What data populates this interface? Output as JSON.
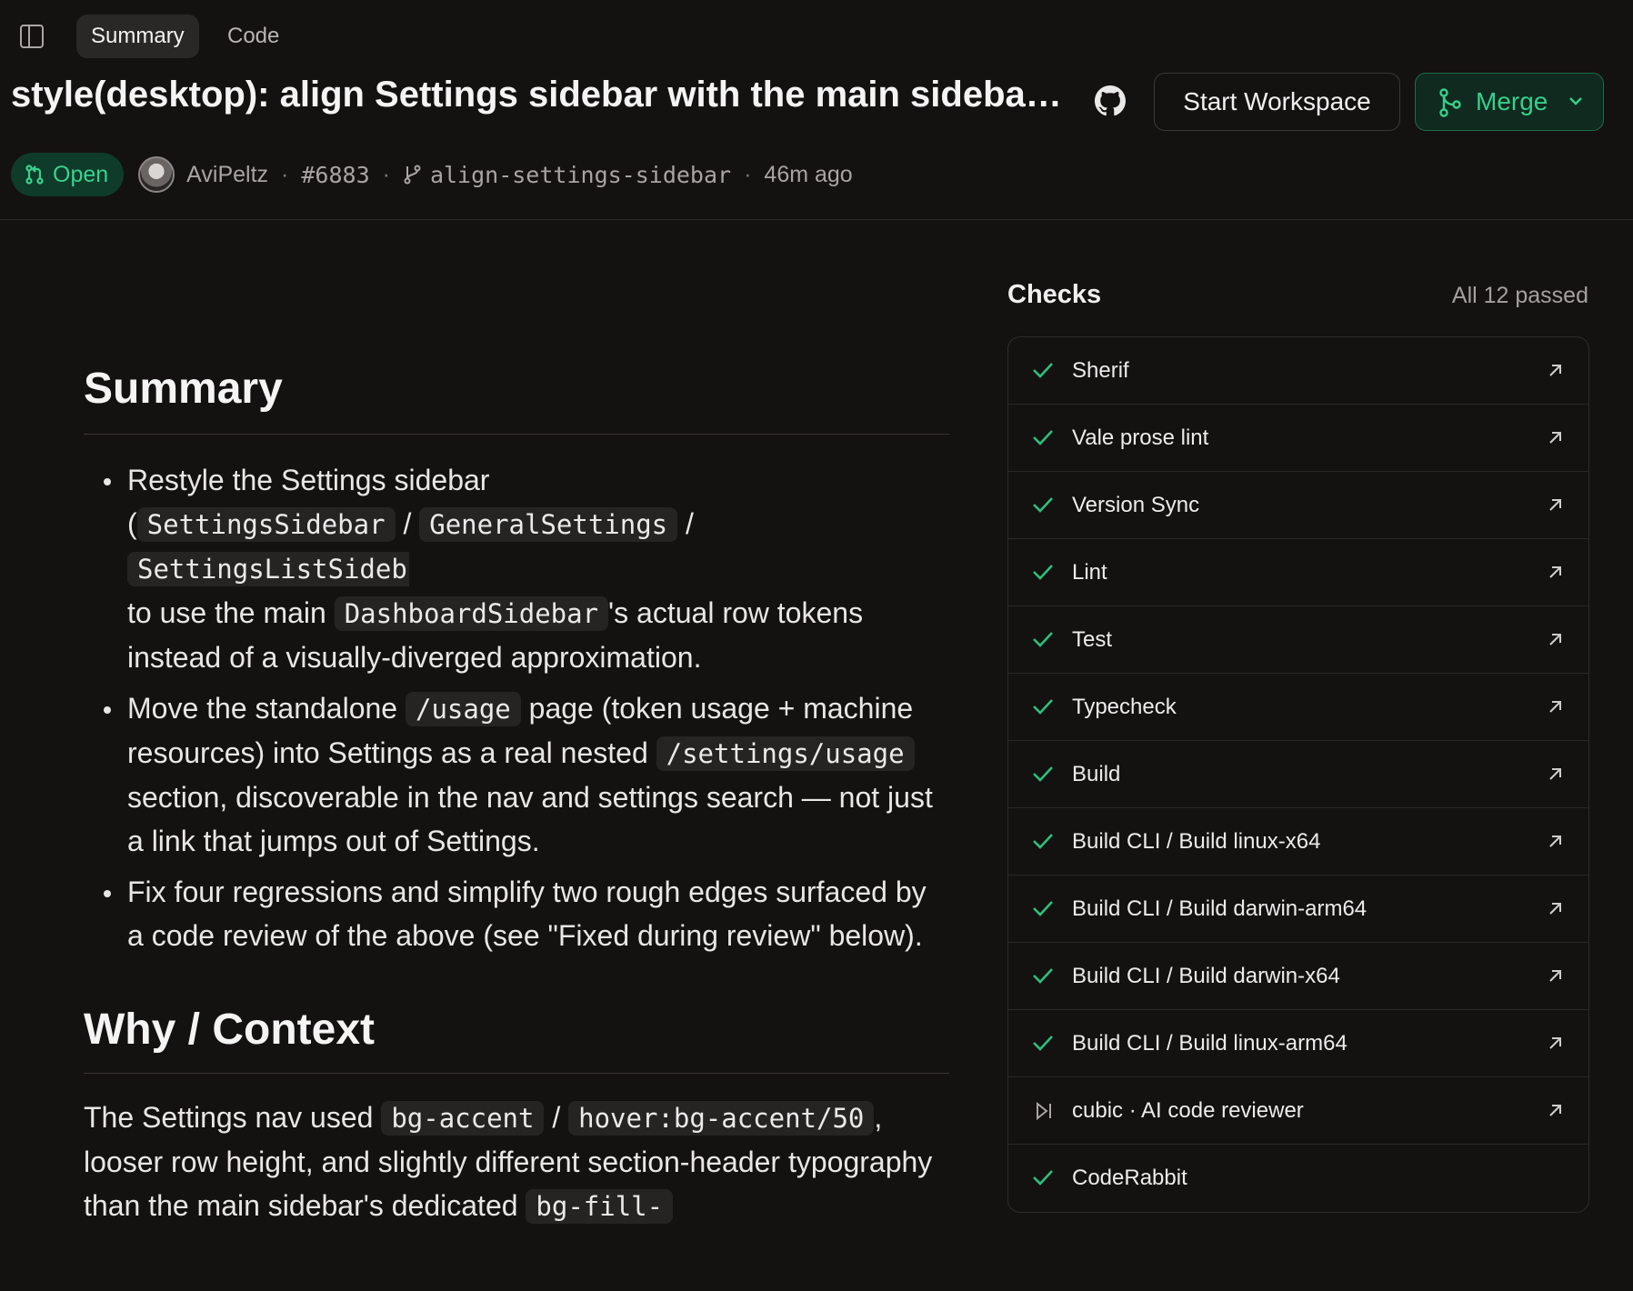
{
  "tabs": [
    {
      "label": "Summary",
      "active": true
    },
    {
      "label": "Code",
      "active": false
    }
  ],
  "header": {
    "title": "style(desktop): align Settings sidebar with the main sidebar, f...",
    "start_workspace_label": "Start Workspace",
    "merge_label": "Merge"
  },
  "meta": {
    "status": "Open",
    "author": "AviPeltz",
    "sep": "·",
    "pr_number": "#6883",
    "branch": "align-settings-sidebar",
    "time": "46m ago"
  },
  "content": {
    "summary_heading": "Summary",
    "bullet1": {
      "t1": "Restyle the Settings sidebar",
      "t2": "(",
      "c1": "SettingsSidebar",
      "t3": "/",
      "c2": "GeneralSettings",
      "t4": "/",
      "c3": "SettingsListSideb",
      "t5": "to use the main",
      "c4": "DashboardSidebar",
      "t6": "'s actual row tokens instead of a visually-diverged approximation."
    },
    "bullet2": {
      "t1": "Move the standalone",
      "c1": "/usage",
      "t2": "page (token usage + machine resources) into Settings as a real nested",
      "c2": "/settings/usage",
      "t3": "section, discoverable in the nav and settings search — not just a link that jumps out of Settings."
    },
    "bullet3": {
      "t1": "Fix four regressions and simplify two rough edges surfaced by a code review of the above (see \"Fixed during review\" below)."
    },
    "context_heading": "Why / Context",
    "para": {
      "t1": "The Settings nav used",
      "c1": "bg-accent",
      "t2": "/",
      "c2": "hover:bg-accent/50",
      "t3": ", looser row height, and slightly different section-header typography than the main sidebar's dedicated",
      "c3": "bg-fill-"
    }
  },
  "checks": {
    "title": "Checks",
    "summary": "All 12 passed",
    "items": [
      {
        "name": "Sherif",
        "status": "passed",
        "link": true
      },
      {
        "name": "Vale prose lint",
        "status": "passed",
        "link": true
      },
      {
        "name": "Version Sync",
        "status": "passed",
        "link": true
      },
      {
        "name": "Lint",
        "status": "passed",
        "link": true
      },
      {
        "name": "Test",
        "status": "passed",
        "link": true
      },
      {
        "name": "Typecheck",
        "status": "passed",
        "link": true
      },
      {
        "name": "Build",
        "status": "passed",
        "link": true
      },
      {
        "name": "Build CLI / Build linux-x64",
        "status": "passed",
        "link": true
      },
      {
        "name": "Build CLI / Build darwin-arm64",
        "status": "passed",
        "link": true
      },
      {
        "name": "Build CLI / Build darwin-x64",
        "status": "passed",
        "link": true
      },
      {
        "name": "Build CLI / Build linux-arm64",
        "status": "passed",
        "link": true
      },
      {
        "name": "cubic · AI code reviewer",
        "status": "skipped",
        "link": true
      },
      {
        "name": "CodeRabbit",
        "status": "passed",
        "link": false
      }
    ]
  },
  "colors": {
    "background": "#141111",
    "accent_green": "#36d08a",
    "check_green": "#2fbf7c"
  },
  "icons": {
    "sidebar_toggle": "sidebar-toggle-icon",
    "github": "github-icon",
    "merge": "git-merge-icon",
    "chevron": "chevron-down-icon",
    "pr": "git-pull-request-icon",
    "branch": "git-branch-icon",
    "check": "check-icon",
    "skip": "skip-icon",
    "external": "external-link-icon"
  }
}
